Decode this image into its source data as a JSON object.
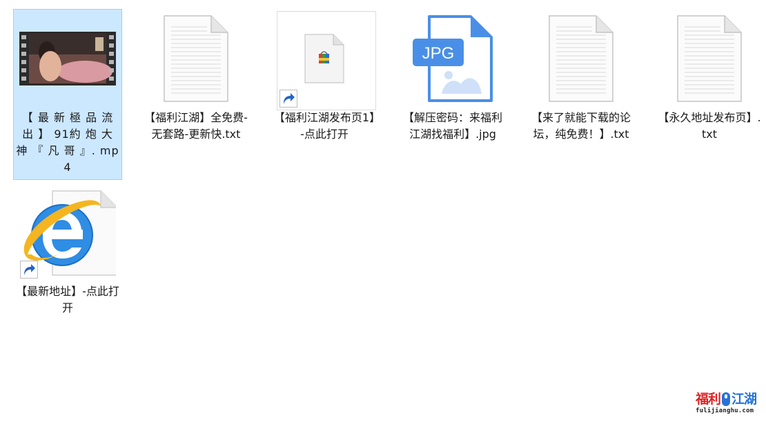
{
  "files": [
    {
      "label": "【 最 新 極 品 流 出 】 91約 炮 大 神 『 凡 哥 』. mp4",
      "type": "video",
      "icon": "video-thumbnail-icon",
      "selected": true
    },
    {
      "label": "【福利江湖】全免费-无套路-更新快.txt",
      "type": "text",
      "icon": "text-file-icon"
    },
    {
      "label": "【福利江湖发布页1】-点此打开",
      "type": "shortcut",
      "icon": "web-shortcut-icon"
    },
    {
      "label": "【解压密码：来福利江湖找福利】.jpg",
      "type": "image",
      "icon": "jpg-file-icon",
      "badge": "JPG"
    },
    {
      "label": "【来了就能下载的论坛，纯免费！】.txt",
      "type": "text",
      "icon": "text-file-icon"
    },
    {
      "label": "【永久地址发布页】.txt",
      "type": "text",
      "icon": "text-file-icon"
    },
    {
      "label": "【最新地址】-点此打开",
      "type": "shortcut",
      "icon": "internet-explorer-icon"
    }
  ],
  "watermark": {
    "text_red": "福利",
    "text_blue": "江湖",
    "domain": "fulijianghu.com"
  },
  "colors": {
    "selection_bg": "#cce8ff",
    "selection_border": "#99d1ff",
    "jpg_blue": "#4a8fe7",
    "watermark_red": "#e02020",
    "watermark_blue": "#2673d9"
  }
}
